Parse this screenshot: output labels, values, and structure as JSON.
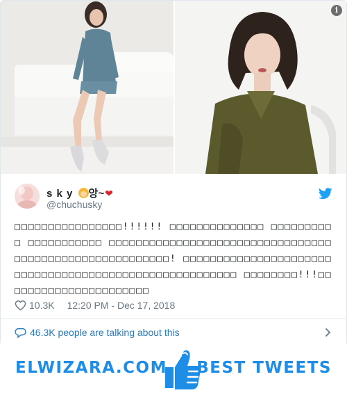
{
  "tweet": {
    "author_name": "s k y",
    "author_name_suffix": "앙~",
    "author_handle": "@chuchusky",
    "body": "□□□□□□□□□□□□□□□□!!!!!! □□□□□□□□□□□□□□ □□□□□□□□□□ □□□□□□□□□□□ □□□□□□□□□□□□□□□□□□□□□□□□□□□□□□□□□□□□□□□□□□□□□□□□□□□□□□□□! □□□□□□□□□□□□□□□□□□□□□□□□□□□□□□□□□□□□□□□□□□□□□□□□□□□□□□□ □□□□□□□□!!!□□□□□□□□□□□□□□□□□□□□□□",
    "like_count": "10.3K",
    "timestamp": "12:20 PM - Dec 17, 2018",
    "talking_text": "46.3K people are talking about this"
  },
  "media": {
    "info_badge": "i"
  },
  "banner": {
    "left_text": "ELWIZARA.COM",
    "right_text": "BEST TWEETS"
  },
  "icons": {
    "twitter_logo": "twitter-bird-icon",
    "like": "heart-outline-icon",
    "talking": "speech-bubble-icon",
    "more": "chevron-right-icon",
    "banner": "thumbs-up-icon"
  },
  "colors": {
    "twitter_blue": "#1da1f2",
    "link_blue": "#2b7bb9",
    "muted_gray": "#697882",
    "banner_blue": "#1d8de6",
    "heart_red": "#d8232a"
  }
}
